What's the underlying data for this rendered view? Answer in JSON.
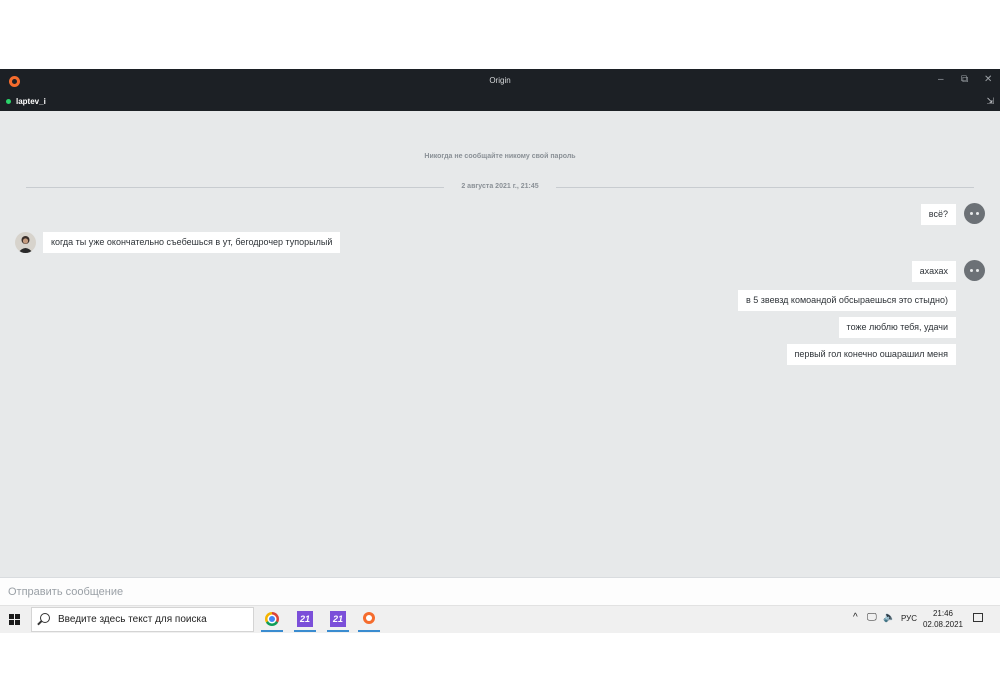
{
  "window": {
    "title": "Origin",
    "minimize": "–",
    "restore": "⧉",
    "close": "✕",
    "popout": "⇲"
  },
  "user": {
    "name": "laptev_i",
    "status_color": "#2bd46b"
  },
  "chat": {
    "notice": "Никогда не сообщайте никому свой пароль",
    "date_separator": "2 августа 2021 г., 21:45",
    "messages": [
      {
        "from": "me",
        "text": "всё?"
      },
      {
        "from": "them",
        "text": "когда ты уже окончательно съебешься в ут, бегодрочер тупорылый"
      },
      {
        "from": "me",
        "text": "ахахах"
      },
      {
        "from": "me",
        "text": "в 5 звевзд комоандой обсыраешься это стыдно)"
      },
      {
        "from": "me",
        "text": "тоже люблю тебя, удачи"
      },
      {
        "from": "me",
        "text": "первый гол конечно ошарашил меня"
      }
    ]
  },
  "composer": {
    "placeholder": "Отправить сообщение",
    "value": ""
  },
  "taskbar": {
    "search_placeholder": "Введите здесь текст для поиска",
    "apps": [
      {
        "name": "chrome-icon"
      },
      {
        "name": "app-21-icon",
        "label": "21"
      },
      {
        "name": "app-21-icon",
        "label": "21"
      },
      {
        "name": "origin-icon"
      }
    ],
    "tray": {
      "chevron": "^",
      "lang": "РУС",
      "network": "🖵",
      "volume": "🔈"
    },
    "clock": {
      "time": "21:46",
      "date": "02.08.2021"
    }
  }
}
